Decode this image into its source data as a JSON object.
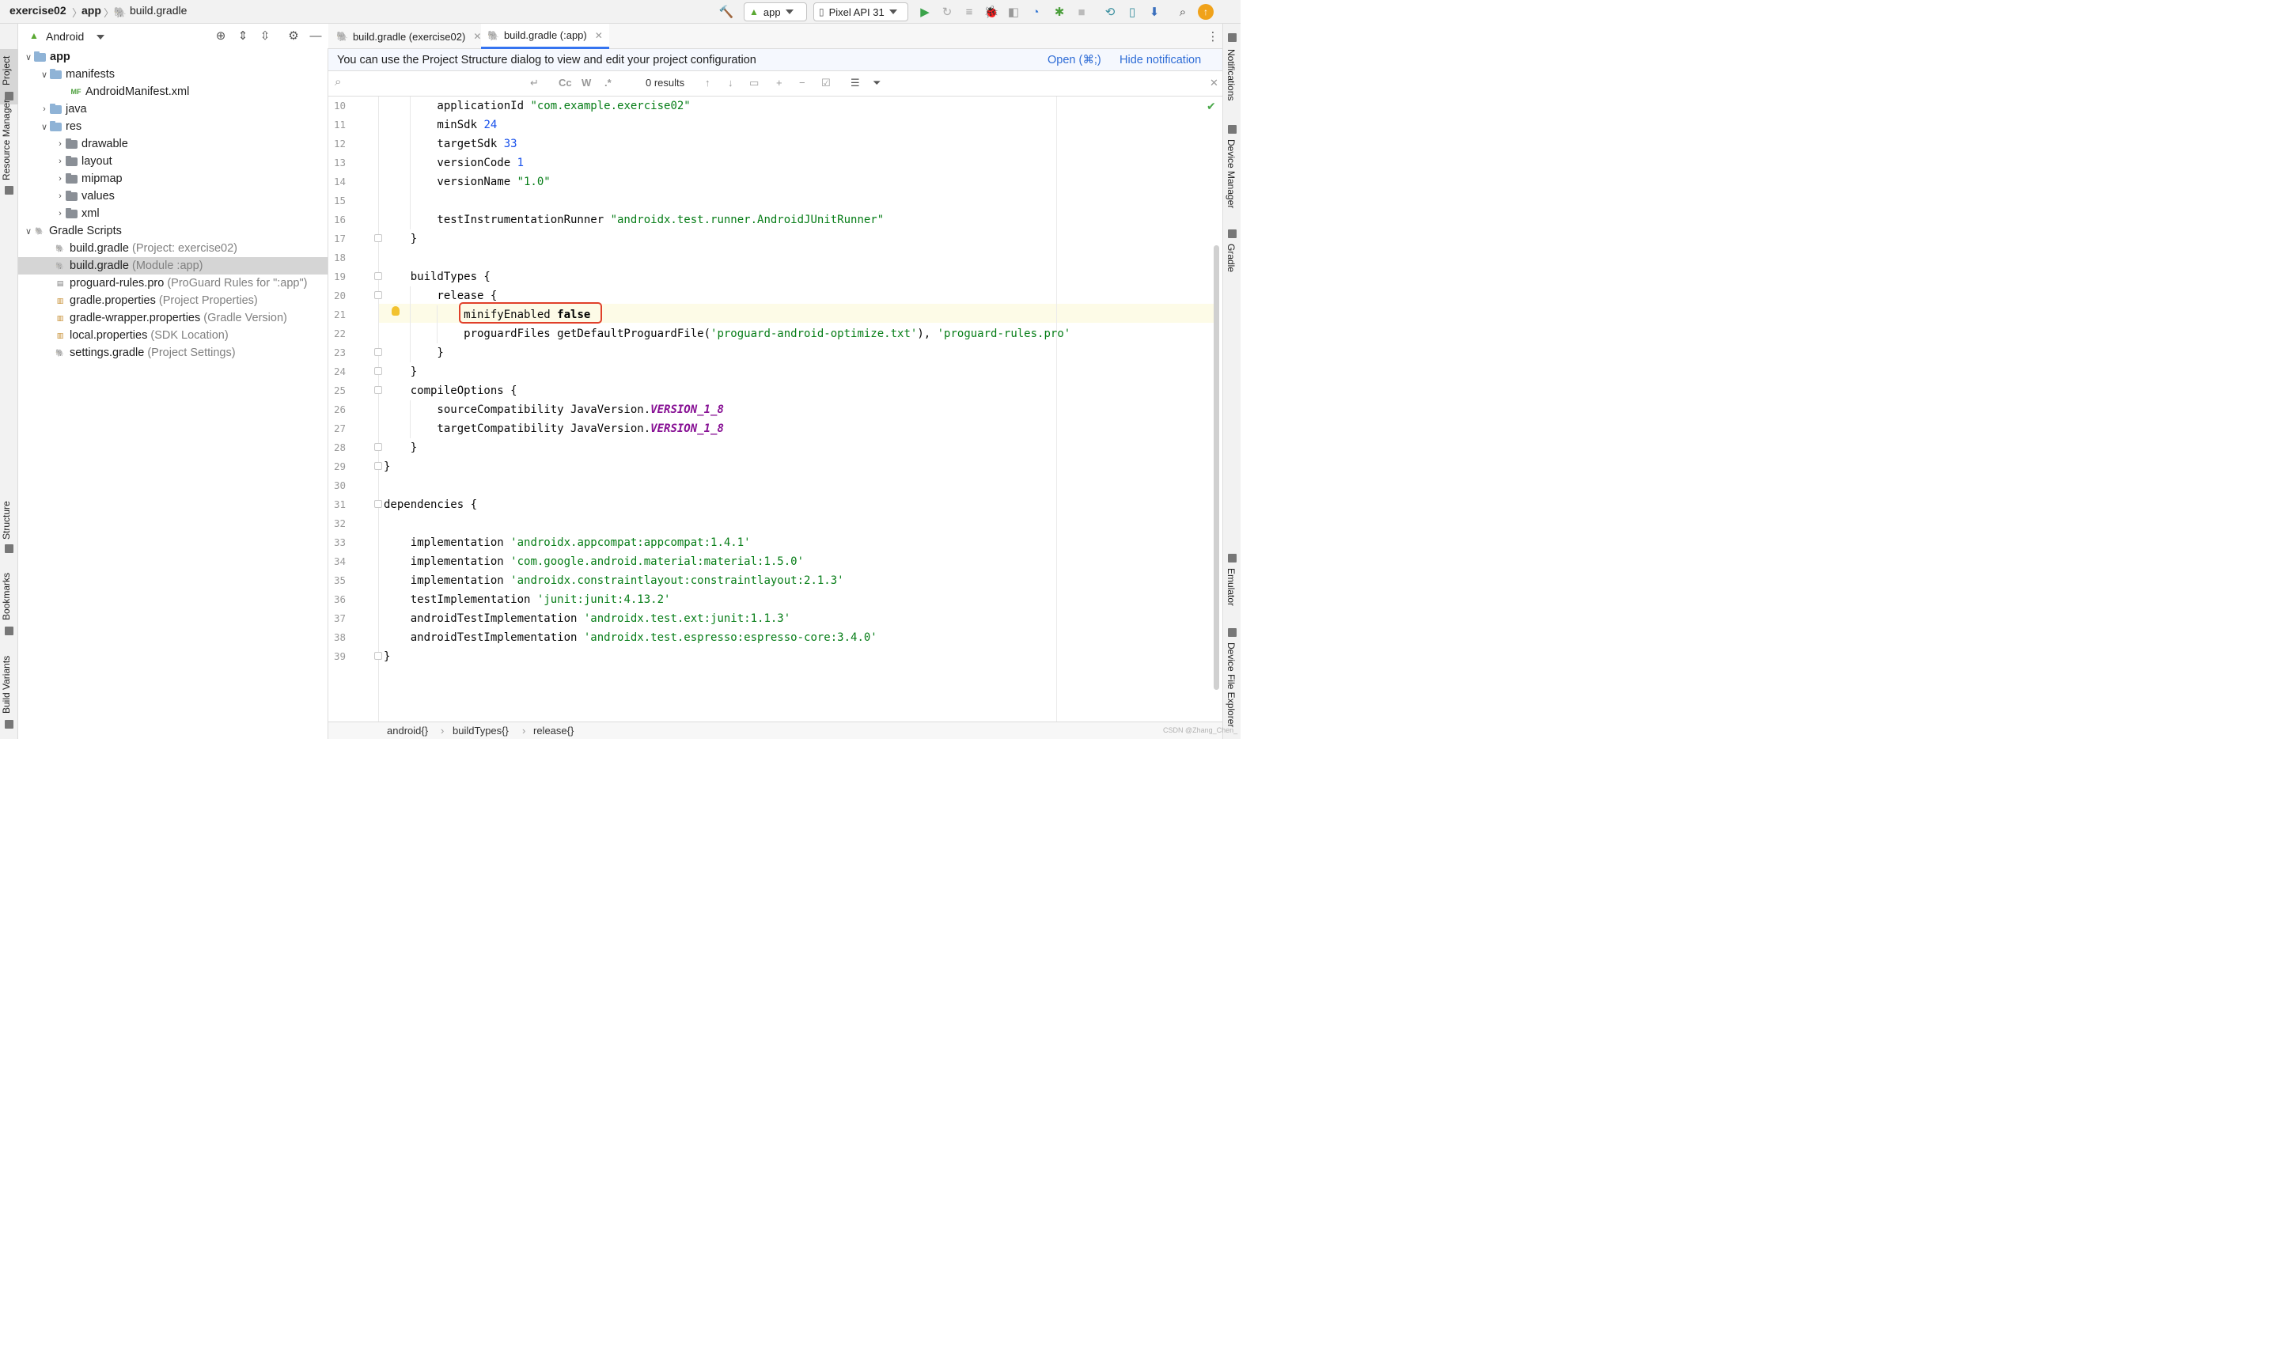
{
  "breadcrumb": {
    "project": "exercise02",
    "module": "app",
    "file": "build.gradle"
  },
  "toolbar": {
    "run_config": "app",
    "device": "Pixel API 31"
  },
  "left_strip": {
    "project": "Project",
    "resource_manager": "Resource Manager",
    "structure": "Structure",
    "bookmarks": "Bookmarks",
    "build_variants": "Build Variants"
  },
  "right_strip": {
    "notifications": "Notifications",
    "device_manager": "Device Manager",
    "gradle": "Gradle",
    "emulator": "Emulator",
    "device_file_explorer": "Device File Explorer"
  },
  "project_panel": {
    "view_mode": "Android",
    "tree": [
      {
        "label": "app",
        "hint": ""
      },
      {
        "label": "manifests",
        "hint": ""
      },
      {
        "label": "AndroidManifest.xml",
        "hint": ""
      },
      {
        "label": "java",
        "hint": ""
      },
      {
        "label": "res",
        "hint": ""
      },
      {
        "label": "drawable",
        "hint": ""
      },
      {
        "label": "layout",
        "hint": ""
      },
      {
        "label": "mipmap",
        "hint": ""
      },
      {
        "label": "values",
        "hint": ""
      },
      {
        "label": "xml",
        "hint": ""
      },
      {
        "label": "Gradle Scripts",
        "hint": ""
      },
      {
        "label": "build.gradle",
        "hint": "(Project: exercise02)"
      },
      {
        "label": "build.gradle",
        "hint": "(Module :app)"
      },
      {
        "label": "proguard-rules.pro",
        "hint": "(ProGuard Rules for \":app\")"
      },
      {
        "label": "gradle.properties",
        "hint": "(Project Properties)"
      },
      {
        "label": "gradle-wrapper.properties",
        "hint": "(Gradle Version)"
      },
      {
        "label": "local.properties",
        "hint": "(SDK Location)"
      },
      {
        "label": "settings.gradle",
        "hint": "(Project Settings)"
      }
    ]
  },
  "tabs": [
    {
      "label": "build.gradle (exercise02)"
    },
    {
      "label": "build.gradle (:app)"
    }
  ],
  "notification": {
    "message": "You can use the Project Structure dialog to view and edit your project configuration",
    "open_label": "Open (⌘;)",
    "hide_label": "Hide notification"
  },
  "search": {
    "results": "0 results",
    "match_case": "Cc",
    "words": "W",
    "regex": ".*"
  },
  "editor": {
    "line_numbers": [
      "10",
      "11",
      "12",
      "13",
      "14",
      "15",
      "16",
      "17",
      "18",
      "19",
      "20",
      "21",
      "22",
      "23",
      "24",
      "25",
      "26",
      "27",
      "28",
      "29",
      "30",
      "31",
      "32",
      "33",
      "34",
      "35",
      "36",
      "37",
      "38",
      "39"
    ],
    "code": {
      "l10a": "        applicationId ",
      "l10s": "\"com.example.exercise02\"",
      "l11a": "        minSdk ",
      "l11n": "24",
      "l12a": "        targetSdk ",
      "l12n": "33",
      "l13a": "        versionCode ",
      "l13n": "1",
      "l14a": "        versionName ",
      "l14s": "\"1.0\"",
      "l16a": "        testInstrumentationRunner ",
      "l16s": "\"androidx.test.runner.AndroidJUnitRunner\"",
      "l17": "    }",
      "l19": "    buildTypes {",
      "l20": "        release {",
      "l21a": "            minifyEnabled ",
      "l21k": "false",
      "l22a": "            proguardFiles getDefaultProguardFile(",
      "l22s1": "'proguard-android-optimize.txt'",
      "l22b": "), ",
      "l22s2": "'proguard-rules.pro'",
      "l23": "        }",
      "l24": "    }",
      "l25": "    compileOptions {",
      "l26a": "        sourceCompatibility JavaVersion.",
      "l26c": "VERSION_1_8",
      "l27a": "        targetCompatibility JavaVersion.",
      "l27c": "VERSION_1_8",
      "l28": "    }",
      "l29": "}",
      "l31": "dependencies {",
      "l33a": "    implementation ",
      "l33s": "'androidx.appcompat:appcompat:1.4.1'",
      "l34a": "    implementation ",
      "l34s": "'com.google.android.material:material:1.5.0'",
      "l35a": "    implementation ",
      "l35s": "'androidx.constraintlayout:constraintlayout:2.1.3'",
      "l36a": "    testImplementation ",
      "l36s": "'junit:junit:4.13.2'",
      "l37a": "    androidTestImplementation ",
      "l37s": "'androidx.test.ext:junit:1.1.3'",
      "l38a": "    androidTestImplementation ",
      "l38s": "'androidx.test.espresso:espresso-core:3.4.0'",
      "l39": "}"
    }
  },
  "status_crumbs": [
    "android{}",
    "buildTypes{}",
    "release{}"
  ],
  "watermark": "CSDN @Zhang_Chen_",
  "colors": {
    "accent": "#3574f0",
    "string": "#067d17",
    "number": "#1750eb",
    "constant": "#871094",
    "highlight_box": "#e0402a"
  }
}
